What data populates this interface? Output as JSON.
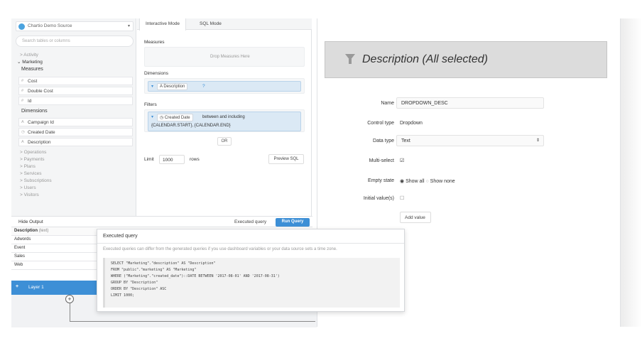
{
  "sidebar": {
    "source": "Chartio Demo Source",
    "search_placeholder": "Search tables or columns",
    "tree": {
      "activity": "> Activity",
      "marketing": "Marketing",
      "measures_label": "Measures",
      "dimensions_label": "Dimensions",
      "measures": [
        {
          "glyph": "#",
          "label": "Cost"
        },
        {
          "glyph": "#",
          "label": "Double Cost"
        },
        {
          "glyph": "#",
          "label": "Id"
        }
      ],
      "dimensions": [
        {
          "glyph": "A",
          "label": "Campaign Id"
        },
        {
          "glyph": "◷",
          "label": "Created Date"
        },
        {
          "glyph": "A",
          "label": "Description"
        }
      ],
      "others": [
        "> Operations",
        "> Payments",
        "> Plans",
        "> Services",
        "> Subscriptions",
        "> Users",
        "> Visitors"
      ]
    }
  },
  "tabs": {
    "interactive": "Interactive Mode",
    "sql": "SQL Mode"
  },
  "builder": {
    "measures_label": "Measures",
    "measures_drop": "Drop Measures Here",
    "dimensions_label": "Dimensions",
    "dimension_chip": "Description",
    "dimension_q": "?",
    "filters_label": "Filters",
    "filter_field": "Created Date",
    "filter_op": "between and including",
    "filter_values": "{CALENDAR.START}, {CALENDAR.END}",
    "or_label": "OR",
    "limit_label": "Limit",
    "limit_value": "1000",
    "rows_label": "rows",
    "preview_sql": "Preview SQL"
  },
  "output": {
    "hide_output": "Hide Output",
    "executed_query": "Executed query",
    "run_query": "Run Query"
  },
  "results": {
    "header": "Description",
    "header_type": "(text)",
    "rows": [
      "Adwords",
      "Event",
      "Sales",
      "Web"
    ]
  },
  "layer": {
    "label": "Layer 1",
    "plus": "+"
  },
  "popover": {
    "title": "Executed query",
    "note": "Executed queries can differ from the generated queries if you use dashboard variables or your data source sets a time zone.",
    "code": [
      "SELECT \"Marketing\".\"description\" AS \"Description\"",
      "FROM \"public\".\"marketing\" AS \"Marketing\"",
      "WHERE (\"Marketing\".\"created_date\")::DATE BETWEEN '2017-08-01' AND '2017-08-31')",
      "GROUP BY \"Description\"",
      "ORDER BY \"Description\" ASC",
      "LIMIT 1000;"
    ]
  },
  "control": {
    "title": "Description (All selected)",
    "name_label": "Name",
    "name_value": "DROPDOWN_DESC",
    "control_type_label": "Control type",
    "control_type_value": "Dropdown",
    "data_type_label": "Data type",
    "data_type_value": "Text",
    "multiselect_label": "Multi-select",
    "empty_state_label": "Empty state",
    "show_all": "Show all",
    "show_none": "Show none",
    "initial_label": "Initial value(s)",
    "add_value": "Add value"
  },
  "colors": {
    "accent": "#3d8fd6",
    "pill": "#dbe9f5"
  }
}
